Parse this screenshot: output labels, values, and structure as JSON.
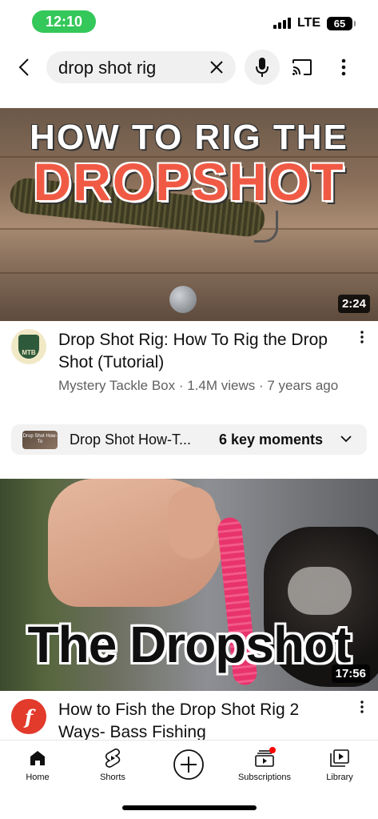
{
  "status_bar": {
    "time": "12:10",
    "network": "LTE",
    "battery": "65",
    "time_pill_color": "#34c759"
  },
  "search": {
    "query": "drop shot rig",
    "icons": [
      "back-arrow-icon",
      "clear-icon",
      "microphone-icon",
      "cast-icon",
      "more-vertical-icon"
    ]
  },
  "videos": [
    {
      "thumbnail_text_line1": "HOW TO RIG THE",
      "thumbnail_text_line2": "DROPSHOT",
      "duration": "2:24",
      "title": "Drop Shot Rig: How To Rig the Drop Shot (Tutorial)",
      "channel": "Mystery Tackle Box",
      "views": "1.4M views",
      "age": "7 years ago",
      "subtitle": "Mystery Tackle Box · 1.4M views · 7 years ago",
      "avatar_text": "MTB",
      "chapters": {
        "thumb_text": "Drop Shot How-To",
        "label": "Drop Shot How-T...",
        "key_moments": "6 key moments"
      }
    },
    {
      "thumbnail_caption": "The Dropshot",
      "duration": "17:56",
      "title": "How to Fish the Drop Shot Rig 2 Ways- Bass Fishing",
      "avatar_text": "f"
    }
  ],
  "bottom_nav": {
    "home": "Home",
    "shorts": "Shorts",
    "subscriptions": "Subscriptions",
    "library": "Library"
  },
  "colors": {
    "accent_red": "#ff0000",
    "thumb_title_red": "#f05a45",
    "search_bg": "#f0f0f0",
    "secondary_text": "#606060"
  }
}
